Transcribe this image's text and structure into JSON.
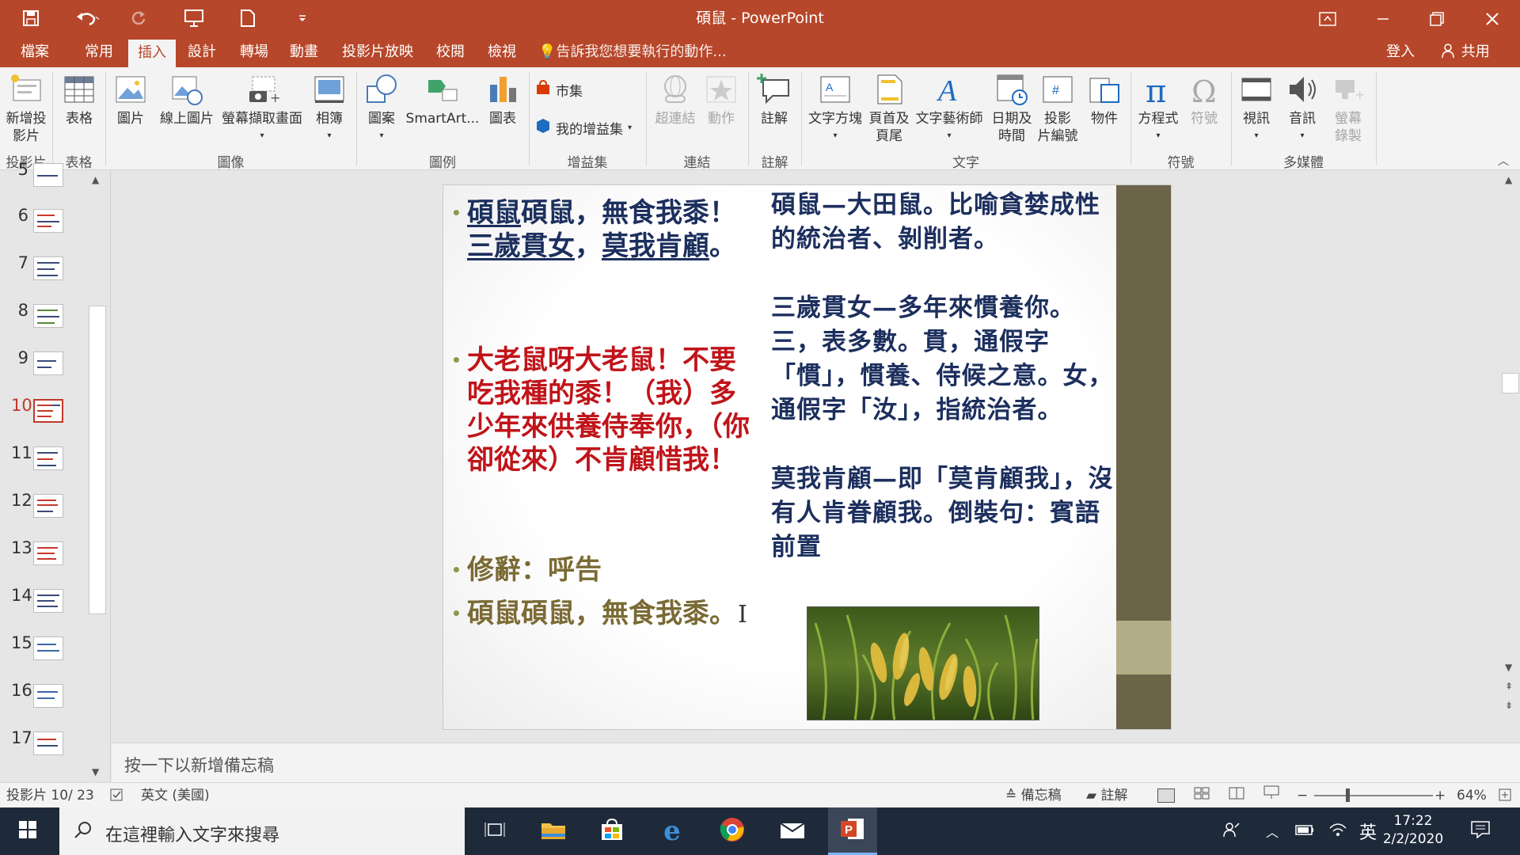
{
  "window": {
    "title": "碩鼠 - PowerPoint"
  },
  "colors": {
    "accent": "#b7472a",
    "slide_sidebar": "#6b6449",
    "red_text": "#c0141a",
    "navy_text": "#1c2f5e"
  },
  "menu": {
    "tabs": [
      "檔案",
      "常用",
      "插入",
      "設計",
      "轉場",
      "動畫",
      "投影片放映",
      "校閱",
      "檢視"
    ],
    "active_tab": "插入",
    "tell_me": "告訴我您想要執行的動作...",
    "sign_in": "登入",
    "share": "共用"
  },
  "ribbon": {
    "buttons": {
      "new_slide": "新增投\n影片",
      "table": "表格",
      "picture": "圖片",
      "online_picture": "線上圖片",
      "screenshot": "螢幕擷取畫面",
      "album": "相簿",
      "shapes": "圖案",
      "smartart": "SmartArt...",
      "chart": "圖表",
      "store": "市集",
      "my_addins": "我的增益集",
      "hyperlink": "超連結",
      "action": "動作",
      "comment": "註解",
      "textbox": "文字方塊",
      "header_footer": "頁首及\n頁尾",
      "wordart": "文字藝術師",
      "datetime": "日期及\n時間",
      "slide_number": "投影\n片編號",
      "object": "物件",
      "equation": "方程式",
      "symbol": "符號",
      "video": "視訊",
      "audio": "音訊",
      "screen_recording": "螢幕\n錄製"
    },
    "groups": {
      "slides": "投影片",
      "tables": "表格",
      "images": "圖像",
      "illustrations": "圖例",
      "addins": "增益集",
      "links": "連結",
      "comments": "註解",
      "text": "文字",
      "symbols": "符號",
      "media": "多媒體"
    }
  },
  "thumbnails": {
    "numbers": [
      "5",
      "6",
      "7",
      "8",
      "9",
      "10",
      "11",
      "12",
      "13",
      "14",
      "15",
      "16",
      "17"
    ],
    "selected": "10"
  },
  "slide": {
    "left": {
      "b1_part1": "碩鼠",
      "b1_part2": "碩鼠，無食我",
      "b1_part3": "黍！",
      "b1_part4": "三歲貫女",
      "b1_part5": "，",
      "b1_part6": "莫",
      "b1_part7": "我肯顧",
      "b1_part8": "。",
      "b2": "大老鼠呀大老鼠！不要吃我種的黍！（我）多少年來供養侍奉你，（你卻從來）不肯顧惜我！",
      "b3": "修辭：呼告",
      "b4": "碩鼠碩鼠，無食我黍。"
    },
    "right": {
      "p1": "碩鼠—大田鼠。比喻貪婪成性的統治者、剝削者。",
      "p2": "三歲貫女—多年來慣養你。三，表多數。貫，通假字「慣」，慣養、侍候之意。女，通假字「汝」，指統治者。",
      "p3": "莫我肯顧—即「莫肯顧我」，沒有人肯眷顧我。倒裝句：賓語前置"
    }
  },
  "notes": {
    "placeholder": "按一下以新增備忘稿"
  },
  "status": {
    "slide_count": "投影片 10/ 23",
    "language": "英文 (美國)",
    "notes_btn": "備忘稿",
    "comments_btn": "註解",
    "zoom": "64%"
  },
  "taskbar": {
    "search_placeholder": "在這裡輸入文字來搜尋",
    "ime": "英",
    "time": "17:22",
    "date": "2/2/2020"
  }
}
